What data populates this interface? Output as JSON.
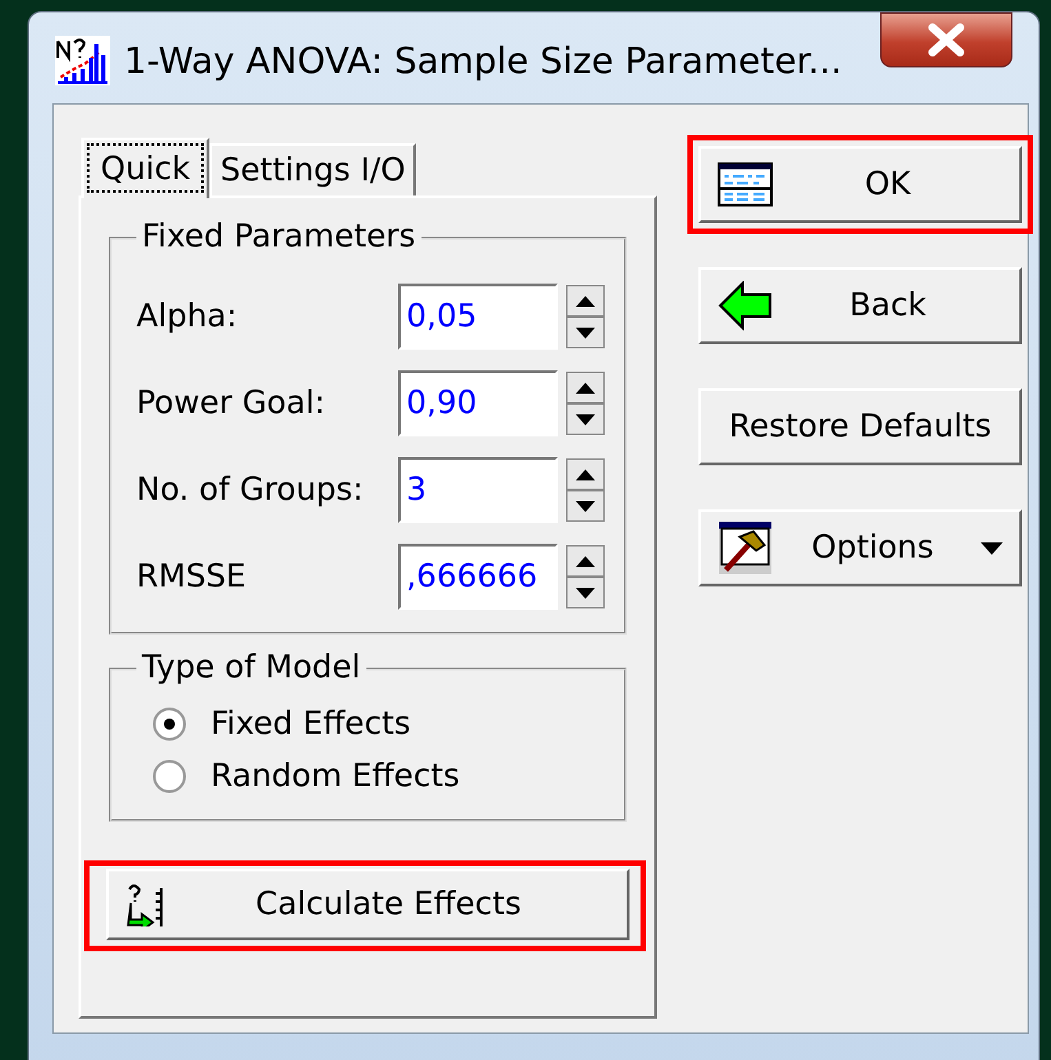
{
  "window": {
    "title": "1-Way ANOVA: Sample Size Parameter..."
  },
  "tabs": [
    {
      "label": "Quick",
      "selected": true
    },
    {
      "label": "Settings I/O",
      "selected": false
    }
  ],
  "fixed_parameters": {
    "title": "Fixed Parameters",
    "fields": [
      {
        "label": "Alpha:",
        "value": "0,05"
      },
      {
        "label": "Power Goal:",
        "value": "0,90"
      },
      {
        "label": "No. of Groups:",
        "value": "3"
      },
      {
        "label": "RMSSE",
        "value": ",666666"
      }
    ]
  },
  "type_of_model": {
    "title": "Type of Model",
    "options": [
      {
        "label": "Fixed Effects",
        "selected": true
      },
      {
        "label": "Random Effects",
        "selected": false
      }
    ]
  },
  "calculate_button": {
    "label": "Calculate Effects",
    "highlighted": true
  },
  "side_buttons": [
    {
      "kind": "ok",
      "label": "OK",
      "highlighted": true
    },
    {
      "kind": "back",
      "label": "Back",
      "highlighted": false
    },
    {
      "kind": "restore",
      "label": "Restore Defaults",
      "highlighted": false
    },
    {
      "kind": "options",
      "label": "Options",
      "highlighted": false
    }
  ]
}
